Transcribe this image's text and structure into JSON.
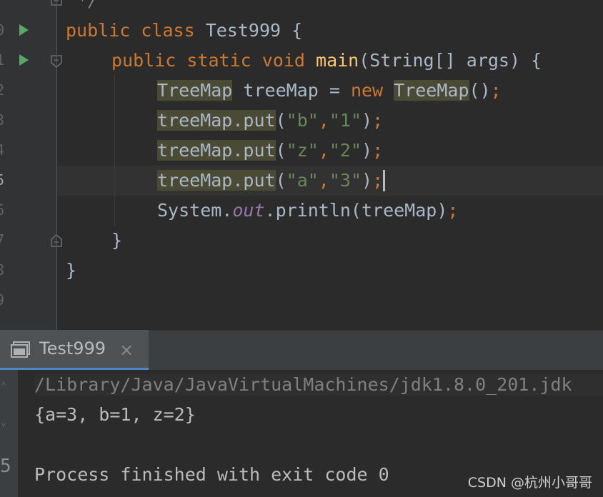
{
  "editor": {
    "line_numbers": [
      "0",
      "1",
      "2",
      "3",
      "4",
      "5",
      "6",
      "7",
      "8",
      "9"
    ],
    "comment_tail": "*/",
    "class_line": {
      "kw1": "public",
      "kw2": "class",
      "name": "Test999",
      "brace": "{"
    },
    "main_line": {
      "kw1": "public",
      "kw2": "static",
      "kw3": "void",
      "fn": "main",
      "params": "(String[] args)",
      "brace": "{"
    },
    "decl_line": {
      "type": "TreeMap",
      "var": " treeMap = ",
      "kw": "new",
      "ctor": "TreeMap",
      "paren": "()",
      "semi": ";"
    },
    "put_lines": [
      {
        "call": "treeMap.put",
        "open": "(",
        "k": "\"b\"",
        "comma": ",",
        "v": "\"1\"",
        "close": ")",
        "semi": ";"
      },
      {
        "call": "treeMap.put",
        "open": "(",
        "k": "\"z\"",
        "comma": ",",
        "v": "\"2\"",
        "close": ")",
        "semi": ";"
      },
      {
        "call": "treeMap.put",
        "open": "(",
        "k": "\"a\"",
        "comma": ",",
        "v": "\"3\"",
        "close": ")",
        "semi": ";"
      }
    ],
    "print_line": {
      "obj": "System.",
      "field": "out",
      "rest": ".println(treeMap)",
      "semi": ";"
    },
    "close_main": "}",
    "close_class": "}"
  },
  "run_panel": {
    "tab_label": "Test999",
    "close_glyph": "×",
    "output": [
      "/Library/Java/JavaVirtualMachines/jdk1.8.0_201.jdk",
      "{a=3, b=1, z=2}",
      "",
      "Process finished with exit code 0"
    ]
  },
  "watermark": "CSDN @杭州小哥哥",
  "colors": {
    "editor_bg": "#2b2b2b",
    "keyword": "#cc7832",
    "function": "#ffc66d",
    "string": "#6a8759",
    "field": "#9876aa",
    "run_icon": "#59a869"
  }
}
